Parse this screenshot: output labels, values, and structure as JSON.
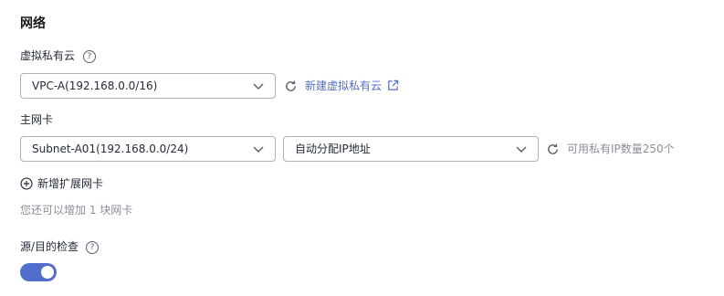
{
  "section_title": "网络",
  "vpc": {
    "label": "虚拟私有云",
    "help": "?",
    "selected": "VPC-A(192.168.0.0/16)",
    "create_link": "新建虚拟私有云"
  },
  "nic": {
    "label": "主网卡",
    "help": "?",
    "subnet_selected": "Subnet-A01(192.168.0.0/24)",
    "ip_selected": "自动分配IP地址",
    "available_ips": "可用私有IP数量250个"
  },
  "add_nic": {
    "label": "新增扩展网卡",
    "hint": "您还可以增加 1 块网卡"
  },
  "source_dest_check": {
    "label": "源/目的检查",
    "help": "?",
    "enabled": true
  },
  "colors": {
    "accent": "#526ecc",
    "border": "#adb0b8",
    "muted": "#8a8e99"
  }
}
